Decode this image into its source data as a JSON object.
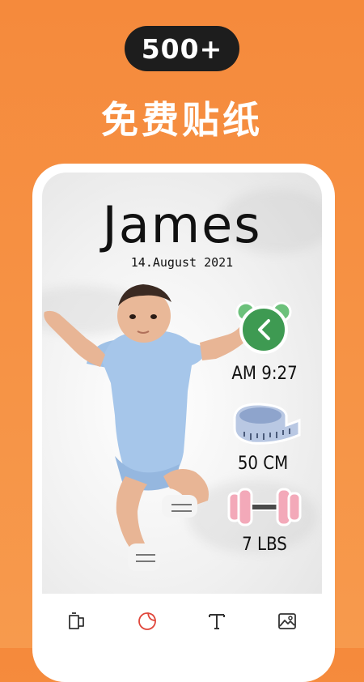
{
  "promo": {
    "badge": "500+",
    "headline": "免费贴纸"
  },
  "card": {
    "name": "James",
    "date": "14.August 2021"
  },
  "stickers": [
    {
      "icon": "alarm-clock-icon",
      "label": "AM 9:27"
    },
    {
      "icon": "tape-measure-icon",
      "label": "50 CM"
    },
    {
      "icon": "dumbbell-icon",
      "label": "7 LBS"
    }
  ],
  "toolbar": {
    "items": [
      "frame-tool-icon",
      "sticker-tool-icon",
      "text-tool-icon",
      "image-tool-icon"
    ],
    "active_color": "#e0463b"
  },
  "colors": {
    "background": "#f58a3c",
    "badge": "#1d1d1d",
    "clock_green": "#3e9a52",
    "clock_ears": "#6cc17b",
    "tape_blue": "#b9c8e3",
    "dumbbell_pink": "#f3a9b9"
  }
}
